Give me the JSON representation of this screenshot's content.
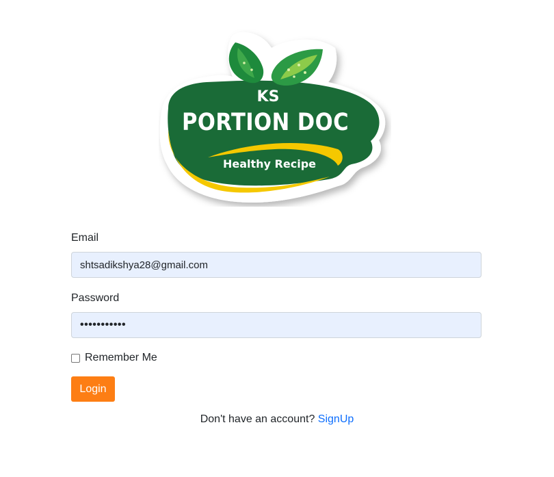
{
  "logo": {
    "top_text": "KS",
    "main_text": "PORTION DOC",
    "sub_text": "Healthy Recipe"
  },
  "form": {
    "email_label": "Email",
    "email_value": "shtsadikshya28@gmail.com",
    "password_label": "Password",
    "password_mask": "•••••••••••",
    "remember_label": "Remember Me",
    "login_label": "Login"
  },
  "footer": {
    "prompt": "Don't have an account?",
    "signup_label": "SignUp"
  },
  "colors": {
    "brand_green": "#1a6b37",
    "brand_yellow": "#f5c800",
    "login_orange": "#fd7e14",
    "link_blue": "#0d6efd",
    "input_fill": "#e8f0fe"
  }
}
